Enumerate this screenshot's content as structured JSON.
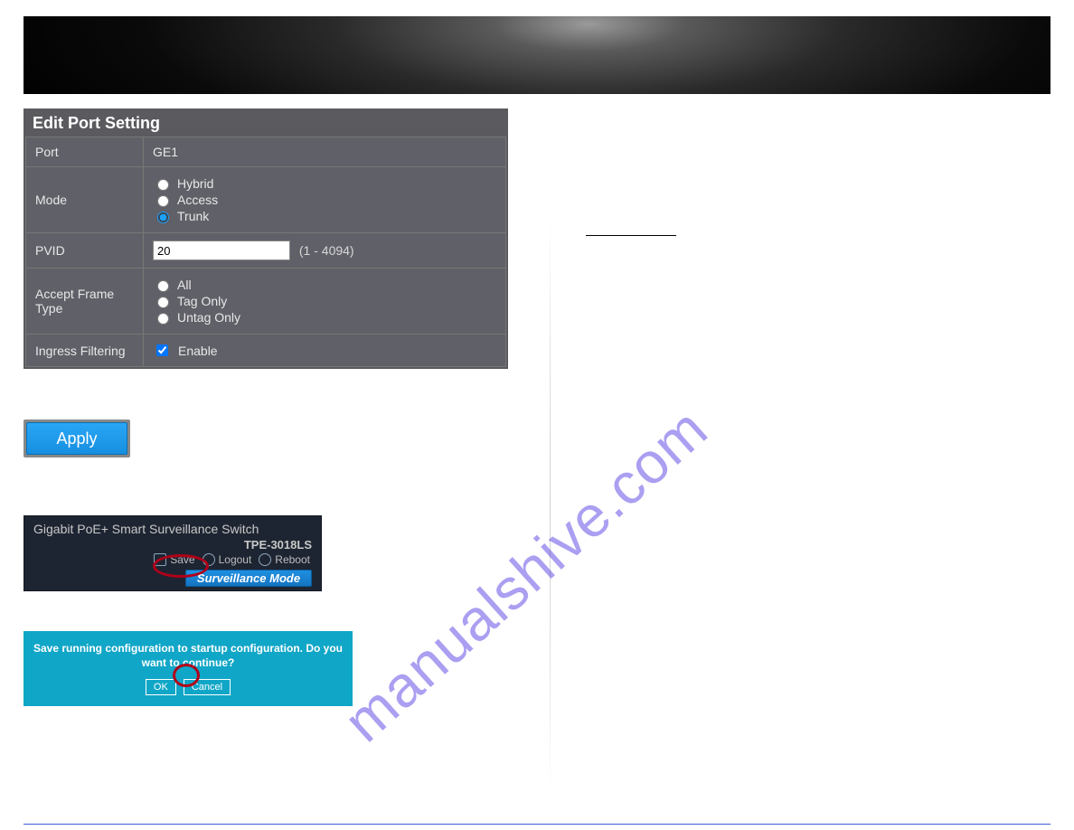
{
  "panel": {
    "title": "Edit Port Setting",
    "rows": {
      "port": {
        "label": "Port",
        "value": "GE1"
      },
      "mode": {
        "label": "Mode",
        "options": {
          "hybrid": "Hybrid",
          "access": "Access",
          "trunk": "Trunk"
        },
        "selected": "trunk"
      },
      "pvid": {
        "label": "PVID",
        "value": "20",
        "hint": "(1 - 4094)"
      },
      "accept": {
        "label": "Accept Frame Type",
        "options": {
          "all": "All",
          "tagonly": "Tag Only",
          "untagonly": "Untag Only"
        },
        "selected": ""
      },
      "ingress": {
        "label": "Ingress Filtering",
        "checkbox_label": "Enable",
        "checked": true
      }
    }
  },
  "apply": {
    "label": "Apply"
  },
  "switch_header": {
    "title": "Gigabit PoE+ Smart Surveillance Switch",
    "model": "TPE-3018LS",
    "links": {
      "save": "Save",
      "logout": "Logout",
      "reboot": "Reboot"
    },
    "mode_button": "Surveillance Mode"
  },
  "confirm": {
    "message": "Save running configuration to startup configuration. Do you want to continue?",
    "ok": "OK",
    "cancel": "Cancel"
  },
  "watermark": "manualshive.com"
}
